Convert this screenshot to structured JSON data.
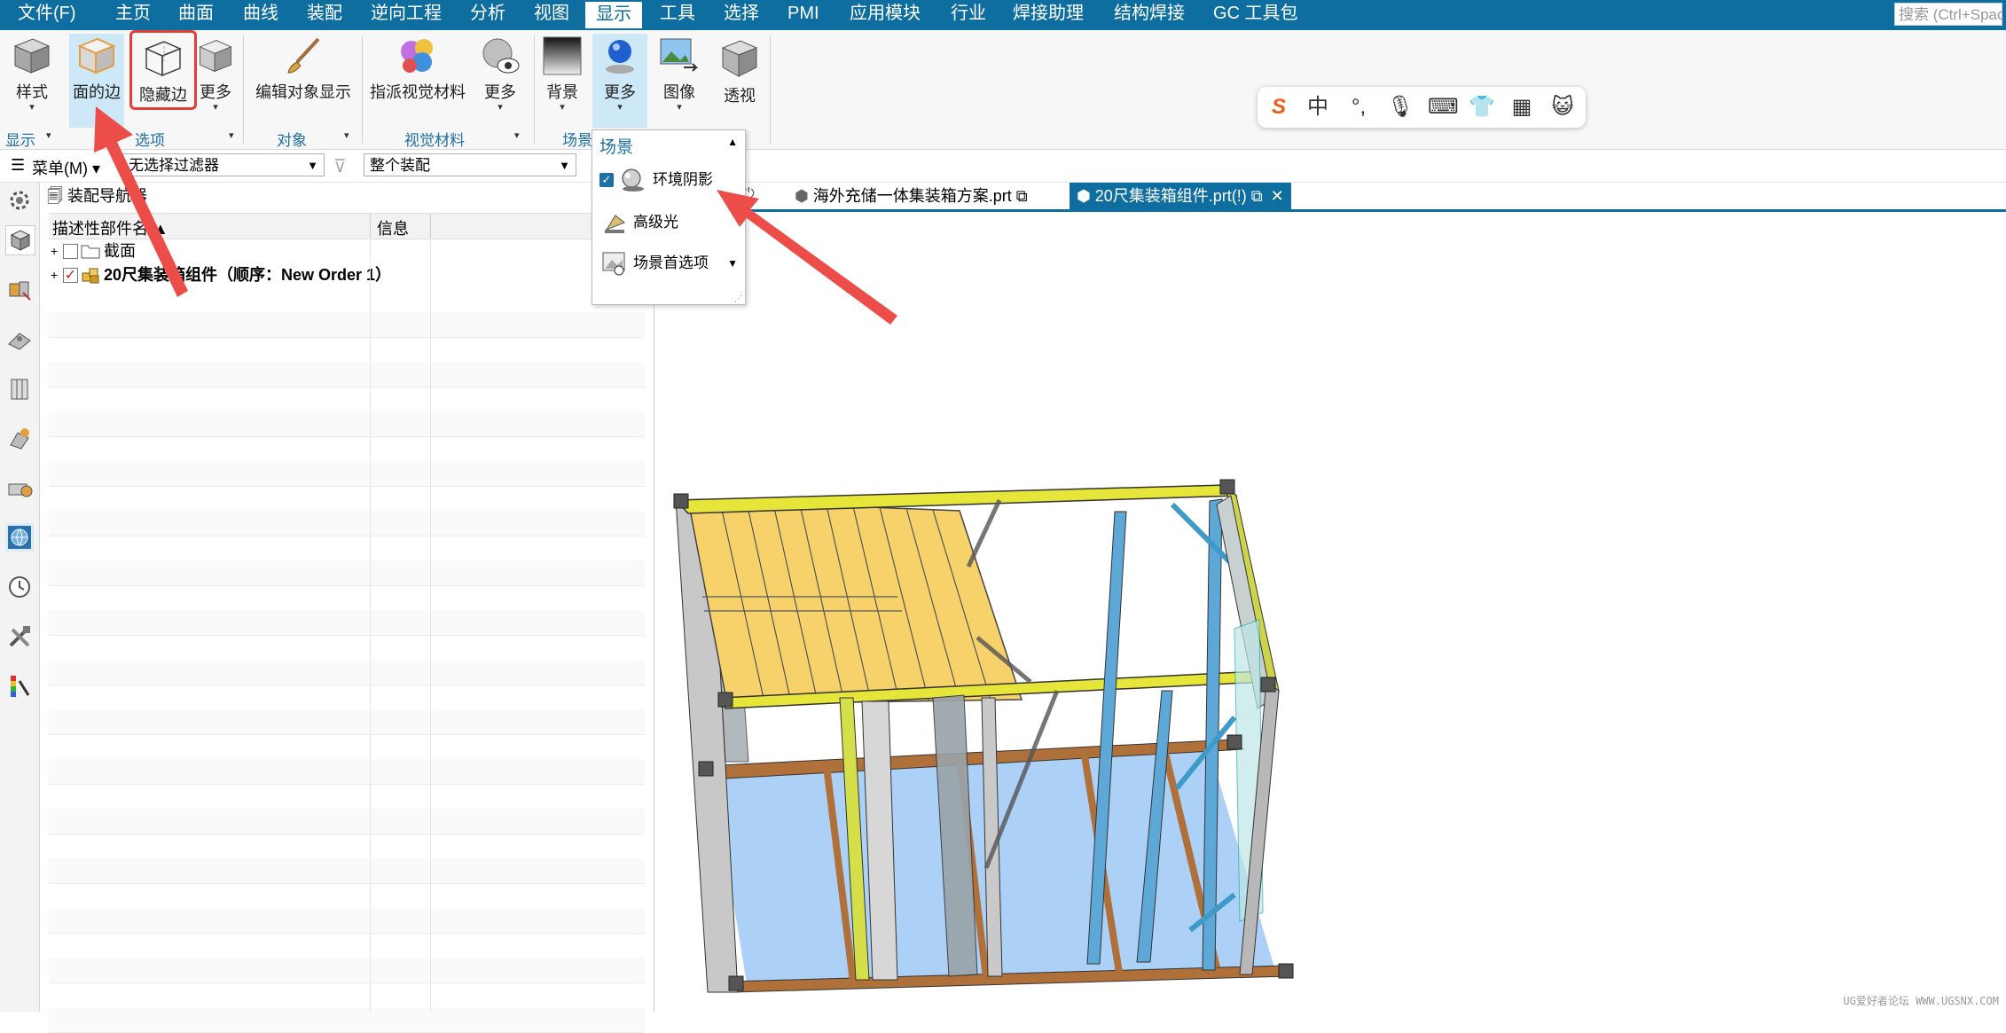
{
  "menubar": {
    "items": [
      "文件(F)",
      "主页",
      "曲面",
      "曲线",
      "装配",
      "逆向工程",
      "分析",
      "视图",
      "显示",
      "工具",
      "选择",
      "PMI",
      "应用模块",
      "行业",
      "焊接助理",
      "结构焊接",
      "GC 工具包"
    ],
    "active_index": 8,
    "search_placeholder": "搜索 (Ctrl+Space)"
  },
  "ribbon": {
    "buttons": {
      "style": "样式",
      "face_edge": "面的边",
      "hidden_edge": "隐藏边",
      "more1": "更多",
      "edit_obj": "编辑对象显示",
      "assign_mat": "指派视觉材料",
      "more2": "更多",
      "background": "背景",
      "more3": "更多",
      "image": "图像",
      "perspective": "透视"
    },
    "groups": {
      "display": "显示",
      "options": "选项",
      "object": "对象",
      "visual_material": "视觉材料",
      "scene": "场景"
    }
  },
  "toolbar2": {
    "menu_label": "菜单(M)",
    "filter_value": "无选择过滤器",
    "assembly_value": "整个装配"
  },
  "navigator": {
    "title": "装配导航器",
    "col_name": "描述性部件名",
    "col_info": "信息",
    "rows": [
      {
        "label": "截面",
        "bold": false,
        "checked": false
      },
      {
        "label": "20尺集装箱组件（顺序：New Order 1）",
        "bold": true,
        "checked": true
      }
    ]
  },
  "tabs": [
    {
      "label": "海外充储一体集装箱方案.prt",
      "active": false
    },
    {
      "label": "20尺集装箱组件.prt(!)",
      "active": true
    }
  ],
  "dropdown": {
    "title": "场景",
    "items": [
      {
        "label": "环境阴影",
        "checked": true
      },
      {
        "label": "高级光",
        "checked": false
      },
      {
        "label": "场景首选项",
        "checked": false
      }
    ]
  },
  "ime": {
    "zh": "中"
  },
  "watermark": "UG爱好者论坛 WWW.UGSNX.COM",
  "colors": {
    "brand": "#0f6ea0",
    "highlight": "#e0403a"
  }
}
